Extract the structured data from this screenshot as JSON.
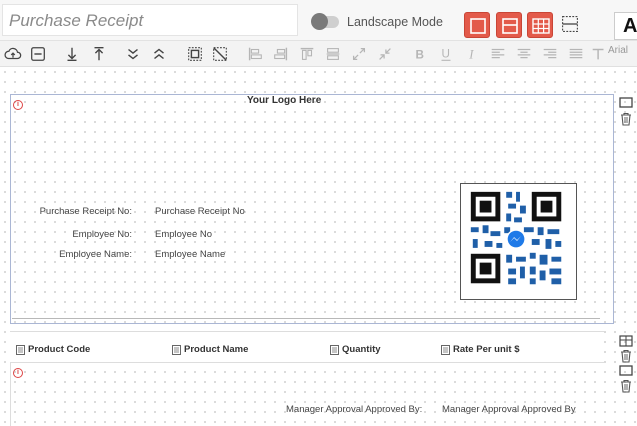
{
  "titlebar": {
    "report_title": "Purchase Receipt",
    "landscape_label": "Landscape Mode",
    "font_button": "A"
  },
  "toolbar": {
    "font_family": "Arial",
    "icons": [
      "upload-icon",
      "minus-box-icon",
      "arrow-down-icon",
      "arrow-up-icon",
      "double-chevron-down-icon",
      "double-chevron-up-icon",
      "select-box-icon",
      "deselect-box-icon",
      "align-left-edge-icon",
      "align-right-edge-icon",
      "align-top-edge-icon",
      "align-middle-icon",
      "expand-icon",
      "compress-icon",
      "bold-icon",
      "underline-icon",
      "italic-icon",
      "text-align-left-icon",
      "text-align-center-icon",
      "text-align-right-icon",
      "text-justify-icon",
      "text-size-icon"
    ]
  },
  "header": {
    "logo_text": "Your Logo Here",
    "fields": [
      {
        "label": "Purchase Receipt No:",
        "value": "Purchase Receipt No"
      },
      {
        "label": "Employee No:",
        "value": "Employee No"
      },
      {
        "label": "Employee Name:",
        "value": "Employee Name"
      }
    ]
  },
  "columns": [
    "Product Code",
    "Product Name",
    "Quantity",
    "Rate Per unit $"
  ],
  "footer": {
    "approval_label": "Manager Approval Approved By:",
    "approval_value": "Manager Approval Approved By"
  },
  "colors": {
    "accent_red": "#e35a4a",
    "band_border": "#aab6d4",
    "qr_blue": "#1f5fa8"
  }
}
